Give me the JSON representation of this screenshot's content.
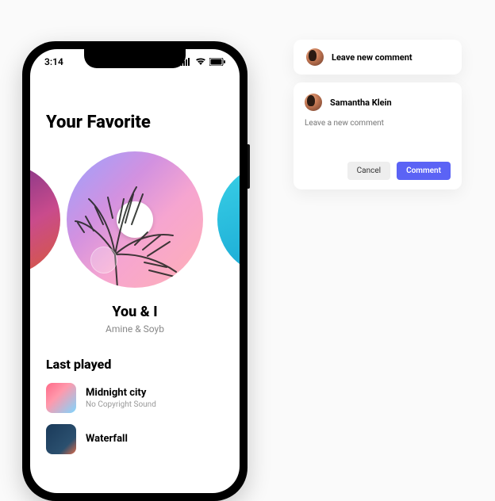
{
  "status": {
    "time": "3:14"
  },
  "favorite": {
    "heading": "Your Favorite",
    "now_playing": {
      "title": "You & I",
      "artist": "Amine & Soyb"
    }
  },
  "last_played": {
    "heading": "Last played",
    "tracks": [
      {
        "title": "Midnight city",
        "sub": "No Copyright Sound"
      },
      {
        "title": "Waterfall",
        "sub": ""
      }
    ]
  },
  "comment_prompt": {
    "label": "Leave new comment"
  },
  "comment_form": {
    "author": "Samantha Klein",
    "placeholder": "Leave a new comment",
    "cancel": "Cancel",
    "submit": "Comment"
  }
}
